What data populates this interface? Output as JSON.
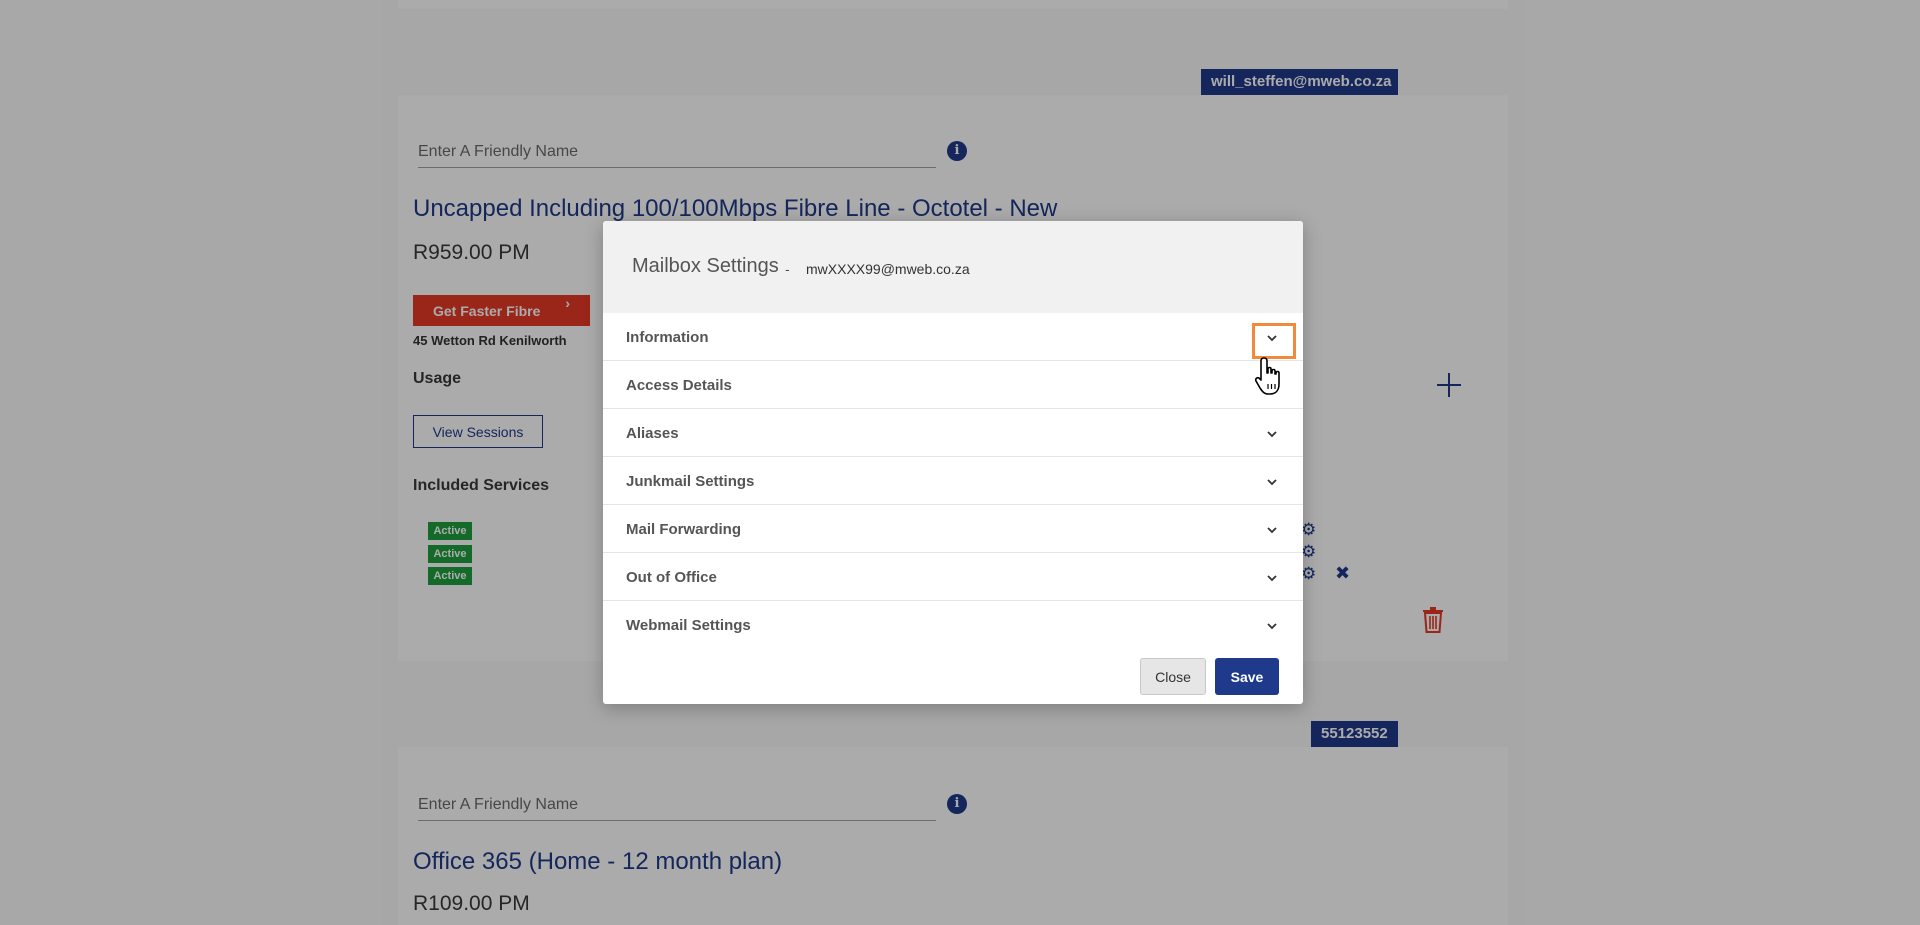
{
  "colors": {
    "brand_blue": "#1f3a8a",
    "accent_red": "#e53a24",
    "active_green": "#1e9e3e",
    "highlight_orange": "#f08a3c",
    "overlay": "rgba(0,0,0,0.33)"
  },
  "account_card": {
    "email_tag": "will_steffen@mweb.co.za",
    "friendly_placeholder": "Enter A Friendly Name",
    "info_icon": "info-icon",
    "product_title": "Uncapped Including 100/100Mbps Fibre Line - Octotel - New",
    "price": "R959.00 PM",
    "faster_fibre_label": "Get Faster Fibre",
    "faster_fibre_chevron": "›",
    "address": "45 Wetton Rd Kenilworth",
    "usage_heading": "Usage",
    "view_sessions_label": "View Sessions",
    "included_services_heading": "Included Services",
    "services": [
      {
        "status": "Active"
      },
      {
        "status": "Active"
      },
      {
        "status": "Active"
      }
    ]
  },
  "second_card": {
    "number_tag": "55123552",
    "friendly_placeholder": "Enter A Friendly Name",
    "product_title": "Office 365 (Home - 12 month plan)",
    "price": "R109.00 PM"
  },
  "modal": {
    "title": "Mailbox Settings",
    "separator": "-",
    "email": "mwXXXX99@mweb.co.za",
    "sections": [
      {
        "label": "Information",
        "icon": "chevron-down-icon"
      },
      {
        "label": "Access Details",
        "icon": ""
      },
      {
        "label": "Aliases",
        "icon": "chevron-down-icon"
      },
      {
        "label": "Junkmail Settings",
        "icon": "chevron-down-icon"
      },
      {
        "label": "Mail Forwarding",
        "icon": "chevron-down-icon"
      },
      {
        "label": "Out of Office",
        "icon": "chevron-down-icon"
      },
      {
        "label": "Webmail Settings",
        "icon": "chevron-down-icon"
      }
    ],
    "close_label": "Close",
    "save_label": "Save"
  }
}
